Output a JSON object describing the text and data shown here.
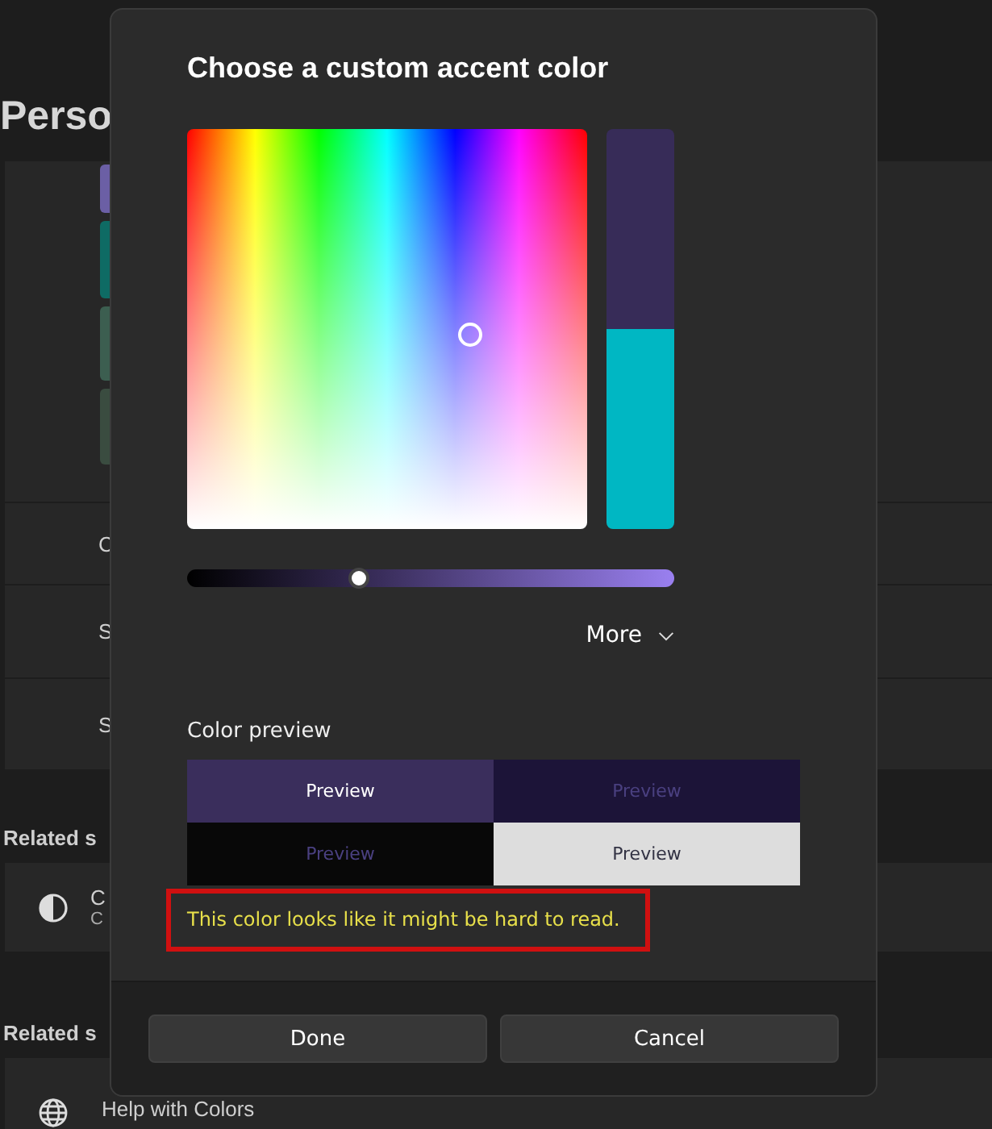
{
  "page": {
    "title": "Perso",
    "accent_swatches": [
      {
        "color": "#6b5fa5"
      },
      {
        "color": "#0e6b64"
      },
      {
        "color": "#3c5e50"
      },
      {
        "color": "#3a4c40"
      }
    ],
    "rows": [
      "C",
      "S",
      "S"
    ],
    "related_settings": {
      "heading": "Related s",
      "items": [
        {
          "title": "C",
          "subtitle": "C"
        }
      ]
    },
    "related_support": {
      "heading": "Related s",
      "items": [
        "Help with Colors"
      ]
    }
  },
  "dialog": {
    "title": "Choose a custom accent color",
    "swatches": [
      {
        "color": "#372c58"
      },
      {
        "color": "#00b7c3"
      }
    ],
    "brightness_slider": {
      "level": 0.35
    },
    "more": {
      "label": "More",
      "expanded": false
    },
    "preview_heading": "Color preview",
    "previews": [
      {
        "label": "Preview",
        "color": "#3a2e5c",
        "kind": "light"
      },
      {
        "label": "Preview",
        "color": "#1c1438",
        "kind": "faint"
      },
      {
        "label": "Preview",
        "color": "#080808",
        "kind": "faint"
      },
      {
        "label": "Preview",
        "color": "#dddddd",
        "kind": "dark"
      }
    ],
    "warning": "This color looks like it might be hard to read.",
    "buttons": [
      "Done",
      "Cancel"
    ]
  }
}
